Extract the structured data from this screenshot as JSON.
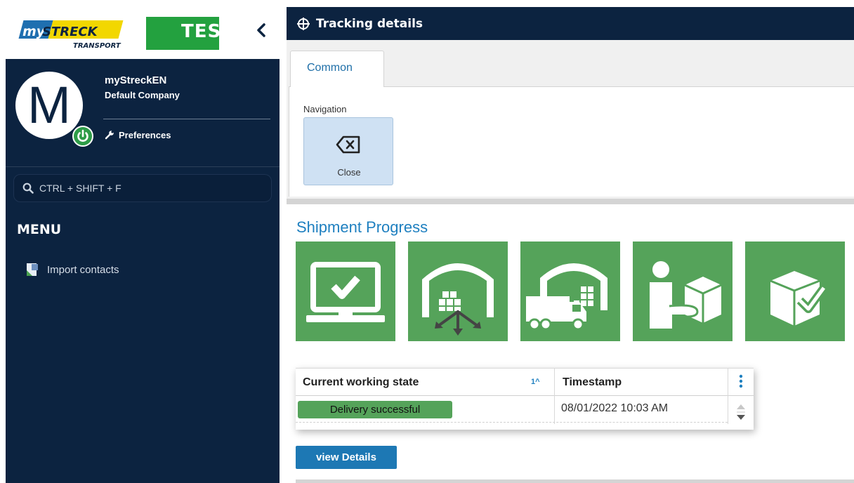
{
  "sidebar": {
    "logo_my": "my",
    "logo_streck": "STRECK",
    "logo_transport": "TRANSPORT",
    "env_badge": "TES",
    "user": {
      "avatar_letter": "M",
      "name": "myStreckEN",
      "company": "Default Company",
      "preferences_label": "Preferences"
    },
    "search": {
      "placeholder": "CTRL + SHIFT + F"
    },
    "menu_heading": "MENU",
    "menu_items": [
      {
        "label": "Import contacts"
      }
    ]
  },
  "header": {
    "title": "Tracking details"
  },
  "tabs": [
    {
      "label": "Common"
    }
  ],
  "toolbar": {
    "group_label": "Navigation",
    "close_label": "Close"
  },
  "shipment": {
    "title": "Shipment Progress",
    "steps": [
      {
        "icon": "order-confirmed-icon"
      },
      {
        "icon": "warehouse-outbound-icon"
      },
      {
        "icon": "warehouse-truck-icon"
      },
      {
        "icon": "package-handover-icon"
      },
      {
        "icon": "package-delivered-icon"
      }
    ],
    "step_color": "#55a35a",
    "table": {
      "columns": [
        "Current working state",
        "Timestamp"
      ],
      "sort_indicator": "1^",
      "rows": [
        {
          "state": "Delivery successful",
          "timestamp": "08/01/2022 10:03 AM"
        }
      ]
    },
    "details_button": "view Details"
  },
  "colors": {
    "navy": "#0c2340",
    "green": "#55a35a",
    "accent_blue": "#1f80c0",
    "button_blue": "#1d78b4",
    "test_green": "#23a13f"
  }
}
